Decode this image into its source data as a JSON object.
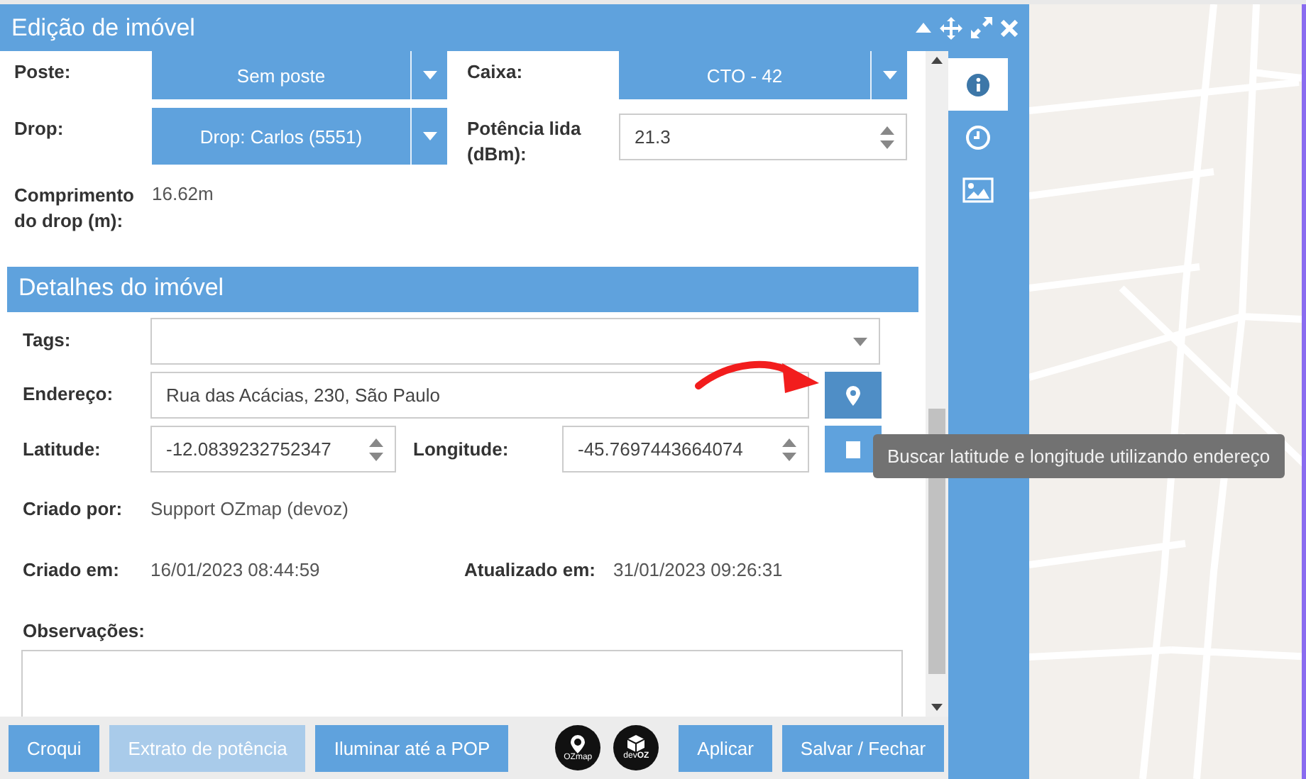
{
  "window": {
    "title": "Edição de imóvel"
  },
  "connection": {
    "rows": [
      [
        {
          "kind": "select",
          "label": "Poste:",
          "value": "Sem poste"
        },
        {
          "kind": "select",
          "label": "Caixa:",
          "value": "CTO - 42"
        }
      ],
      [
        {
          "kind": "select",
          "label": "Drop:",
          "value": "Drop: Carlos (5551)"
        },
        {
          "kind": "number",
          "label": "Potência lida (dBm):",
          "value": "21.3"
        }
      ],
      [
        {
          "kind": "text",
          "label": "Comprimento do drop (m):",
          "value": "16.62m"
        }
      ]
    ]
  },
  "details": {
    "title": "Detalhes do imóvel",
    "rows": [
      [
        {
          "kind": "tags",
          "label": "Tags:"
        }
      ],
      [
        {
          "kind": "address",
          "label": "Endereço:",
          "value": "Rua das Acácias, 230, São Paulo"
        }
      ],
      [
        {
          "kind": "number",
          "label": "Latitude:",
          "value": "-12.0839232752347"
        },
        {
          "kind": "number-action",
          "label": "Longitude:",
          "value": "-45.7697443664074"
        }
      ],
      [
        {
          "kind": "text",
          "label": "Criado por:",
          "value": "Support OZmap (devoz)"
        }
      ],
      [
        {
          "kind": "text",
          "label": "Criado em:",
          "value": "16/01/2023 08:44:59"
        },
        {
          "kind": "text",
          "label": "Atualizado em:",
          "value": "31/01/2023 09:26:31"
        }
      ],
      [
        {
          "kind": "textarea",
          "label": "Observações:"
        }
      ]
    ]
  },
  "tooltip": {
    "text": "Buscar latitude e longitude utilizando endereço"
  },
  "footer": {
    "left_buttons": [
      {
        "label": "Croqui",
        "disabled": false
      },
      {
        "label": "Extrato de potência",
        "disabled": true
      },
      {
        "label": "Iluminar até a POP",
        "disabled": false
      }
    ],
    "logos": [
      {
        "kind": "pin",
        "text": "OZmap"
      },
      {
        "kind": "cube",
        "text": "dev**OZ**"
      }
    ],
    "right_buttons": [
      {
        "label": "Aplicar",
        "disabled": false
      },
      {
        "label": "Salvar / Fechar",
        "disabled": false
      }
    ]
  },
  "side_tabs": [
    {
      "kind": "info",
      "selected": true
    },
    {
      "kind": "history",
      "selected": false
    },
    {
      "kind": "image",
      "selected": false
    }
  ]
}
